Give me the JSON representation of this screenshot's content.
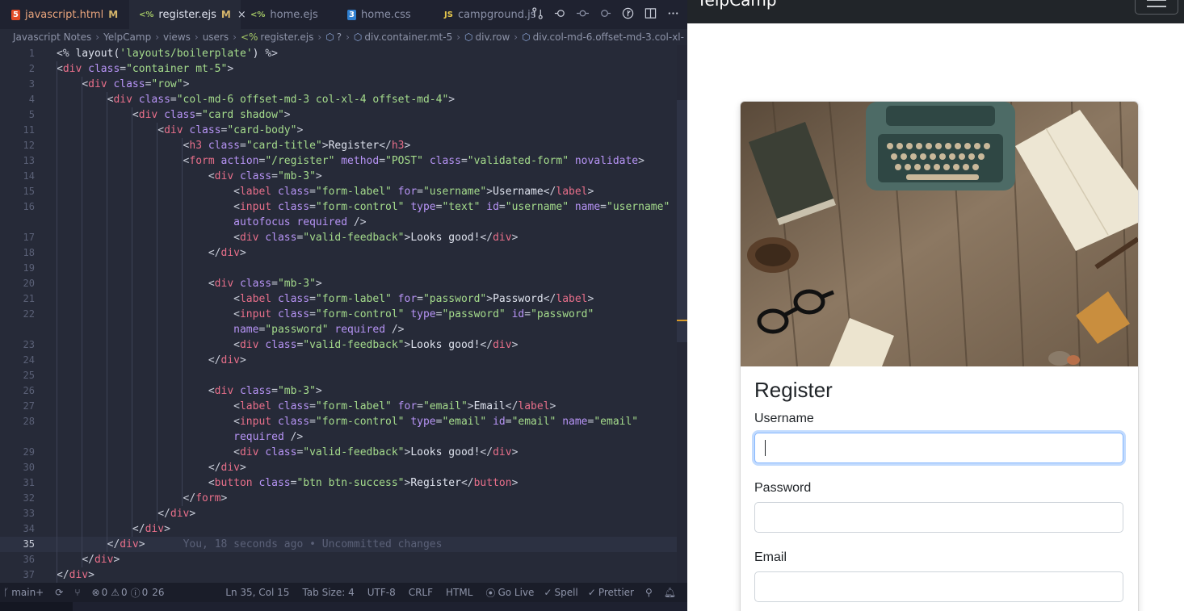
{
  "tabs": [
    {
      "label": "javascript.html",
      "icon": "html5-icon",
      "modified": "M"
    },
    {
      "label": "register.ejs",
      "icon": "ejs-icon",
      "modified": "M",
      "active": true
    },
    {
      "label": "home.ejs",
      "icon": "ejs-icon"
    },
    {
      "label": "home.css",
      "icon": "css-icon"
    },
    {
      "label": "campground.js",
      "icon": "js-icon"
    }
  ],
  "icon_glyphs": {
    "html": "5",
    "ejs": "<%",
    "css": "3",
    "js": "JS",
    "close": "×"
  },
  "breadcrumb": [
    "Javascript Notes",
    "YelpCamp",
    "views",
    "users",
    "register.ejs",
    "?",
    "div.container.mt-5",
    "div.row",
    "div.col-md-6.offset-md-3.col-xl-"
  ],
  "code": {
    "current_line": "35",
    "blame": "You, 18 seconds ago • Uncommitted changes",
    "lines": [
      {
        "n": "1",
        "html": "<span class=\"p\">&lt;% </span><span class=\"x\">layout(</span><span class=\"s\">'layouts/boilerplate'</span><span class=\"x\">) </span><span class=\"p\">%&gt;</span>"
      },
      {
        "n": "2",
        "html": "<span class=\"p\">&lt;</span><span class=\"t\">div</span> <span class=\"a\">class</span><span class=\"p\">=</span><span class=\"s\">\"container mt-5\"</span><span class=\"p\">&gt;</span>"
      },
      {
        "n": "3",
        "html": "    <span class=\"p\">&lt;</span><span class=\"t\">div</span> <span class=\"a\">class</span><span class=\"p\">=</span><span class=\"s\">\"row\"</span><span class=\"p\">&gt;</span>"
      },
      {
        "n": "4",
        "html": "        <span class=\"p\">&lt;</span><span class=\"t\">div</span> <span class=\"a\">class</span><span class=\"p\">=</span><span class=\"s\">\"col-md-6 offset-md-3 col-xl-4 offset-md-4\"</span><span class=\"p\">&gt;</span>"
      },
      {
        "n": "5",
        "html": "            <span class=\"p\">&lt;</span><span class=\"t\">div</span> <span class=\"a\">class</span><span class=\"p\">=</span><span class=\"s\">\"card shadow\"</span><span class=\"p\">&gt;</span>"
      },
      {
        "n": "11",
        "html": "                <span class=\"p\">&lt;</span><span class=\"t\">div</span> <span class=\"a\">class</span><span class=\"p\">=</span><span class=\"s\">\"card-body\"</span><span class=\"p\">&gt;</span>"
      },
      {
        "n": "12",
        "html": "                    <span class=\"p\">&lt;</span><span class=\"t\">h3</span> <span class=\"a\">class</span><span class=\"p\">=</span><span class=\"s\">\"card-title\"</span><span class=\"p\">&gt;</span><span class=\"x\">Register</span><span class=\"p\">&lt;/</span><span class=\"t\">h3</span><span class=\"p\">&gt;</span>"
      },
      {
        "n": "13",
        "html": "                    <span class=\"p\">&lt;</span><span class=\"t\">form</span> <span class=\"a\">action</span><span class=\"p\">=</span><span class=\"s\">\"/register\"</span> <span class=\"a\">method</span><span class=\"p\">=</span><span class=\"s\">\"POST\"</span> <span class=\"a\">class</span><span class=\"p\">=</span><span class=\"s\">\"validated-form\"</span> <span class=\"a\">novalidate</span><span class=\"p\">&gt;</span>"
      },
      {
        "n": "14",
        "html": "                        <span class=\"p\">&lt;</span><span class=\"t\">div</span> <span class=\"a\">class</span><span class=\"p\">=</span><span class=\"s\">\"mb-3\"</span><span class=\"p\">&gt;</span>"
      },
      {
        "n": "15",
        "html": "                            <span class=\"p\">&lt;</span><span class=\"t\">label</span> <span class=\"a\">class</span><span class=\"p\">=</span><span class=\"s\">\"form-label\"</span> <span class=\"a\">for</span><span class=\"p\">=</span><span class=\"s\">\"username\"</span><span class=\"p\">&gt;</span><span class=\"x\">Username</span><span class=\"p\">&lt;/</span><span class=\"t\">label</span><span class=\"p\">&gt;</span>"
      },
      {
        "n": "16",
        "html": "                            <span class=\"p\">&lt;</span><span class=\"t\">input</span> <span class=\"a\">class</span><span class=\"p\">=</span><span class=\"s\">\"form-control\"</span> <span class=\"a\">type</span><span class=\"p\">=</span><span class=\"s\">\"text\"</span> <span class=\"a\">id</span><span class=\"p\">=</span><span class=\"s\">\"username\"</span> <span class=\"a\">name</span><span class=\"p\">=</span><span class=\"s\">\"username\"</span>"
      },
      {
        "n": "",
        "html": "                            <span class=\"a\">autofocus</span> <span class=\"a\">required</span> <span class=\"p\">/&gt;</span>"
      },
      {
        "n": "17",
        "html": "                            <span class=\"p\">&lt;</span><span class=\"t\">div</span> <span class=\"a\">class</span><span class=\"p\">=</span><span class=\"s\">\"valid-feedback\"</span><span class=\"p\">&gt;</span><span class=\"x\">Looks good!</span><span class=\"p\">&lt;/</span><span class=\"t\">div</span><span class=\"p\">&gt;</span>"
      },
      {
        "n": "18",
        "html": "                        <span class=\"p\">&lt;/</span><span class=\"t\">div</span><span class=\"p\">&gt;</span>"
      },
      {
        "n": "19",
        "html": ""
      },
      {
        "n": "20",
        "html": "                        <span class=\"p\">&lt;</span><span class=\"t\">div</span> <span class=\"a\">class</span><span class=\"p\">=</span><span class=\"s\">\"mb-3\"</span><span class=\"p\">&gt;</span>"
      },
      {
        "n": "21",
        "html": "                            <span class=\"p\">&lt;</span><span class=\"t\">label</span> <span class=\"a\">class</span><span class=\"p\">=</span><span class=\"s\">\"form-label\"</span> <span class=\"a\">for</span><span class=\"p\">=</span><span class=\"s\">\"password\"</span><span class=\"p\">&gt;</span><span class=\"x\">Password</span><span class=\"p\">&lt;/</span><span class=\"t\">label</span><span class=\"p\">&gt;</span>"
      },
      {
        "n": "22",
        "html": "                            <span class=\"p\">&lt;</span><span class=\"t\">input</span> <span class=\"a\">class</span><span class=\"p\">=</span><span class=\"s\">\"form-control\"</span> <span class=\"a\">type</span><span class=\"p\">=</span><span class=\"s\">\"password\"</span> <span class=\"a\">id</span><span class=\"p\">=</span><span class=\"s\">\"password\"</span>"
      },
      {
        "n": "",
        "html": "                            <span class=\"a\">name</span><span class=\"p\">=</span><span class=\"s\">\"password\"</span> <span class=\"a\">required</span> <span class=\"p\">/&gt;</span>"
      },
      {
        "n": "23",
        "html": "                            <span class=\"p\">&lt;</span><span class=\"t\">div</span> <span class=\"a\">class</span><span class=\"p\">=</span><span class=\"s\">\"valid-feedback\"</span><span class=\"p\">&gt;</span><span class=\"x\">Looks good!</span><span class=\"p\">&lt;/</span><span class=\"t\">div</span><span class=\"p\">&gt;</span>"
      },
      {
        "n": "24",
        "html": "                        <span class=\"p\">&lt;/</span><span class=\"t\">div</span><span class=\"p\">&gt;</span>"
      },
      {
        "n": "25",
        "html": ""
      },
      {
        "n": "26",
        "html": "                        <span class=\"p\">&lt;</span><span class=\"t\">div</span> <span class=\"a\">class</span><span class=\"p\">=</span><span class=\"s\">\"mb-3\"</span><span class=\"p\">&gt;</span>"
      },
      {
        "n": "27",
        "html": "                            <span class=\"p\">&lt;</span><span class=\"t\">label</span> <span class=\"a\">class</span><span class=\"p\">=</span><span class=\"s\">\"form-label\"</span> <span class=\"a\">for</span><span class=\"p\">=</span><span class=\"s\">\"email\"</span><span class=\"p\">&gt;</span><span class=\"x\">Email</span><span class=\"p\">&lt;/</span><span class=\"t\">label</span><span class=\"p\">&gt;</span>"
      },
      {
        "n": "28",
        "html": "                            <span class=\"p\">&lt;</span><span class=\"t\">input</span> <span class=\"a\">class</span><span class=\"p\">=</span><span class=\"s\">\"form-control\"</span> <span class=\"a\">type</span><span class=\"p\">=</span><span class=\"s\">\"email\"</span> <span class=\"a\">id</span><span class=\"p\">=</span><span class=\"s\">\"email\"</span> <span class=\"a\">name</span><span class=\"p\">=</span><span class=\"s\">\"email\"</span>"
      },
      {
        "n": "",
        "html": "                            <span class=\"a\">required</span> <span class=\"p\">/&gt;</span>"
      },
      {
        "n": "29",
        "html": "                            <span class=\"p\">&lt;</span><span class=\"t\">div</span> <span class=\"a\">class</span><span class=\"p\">=</span><span class=\"s\">\"valid-feedback\"</span><span class=\"p\">&gt;</span><span class=\"x\">Looks good!</span><span class=\"p\">&lt;/</span><span class=\"t\">div</span><span class=\"p\">&gt;</span>"
      },
      {
        "n": "30",
        "html": "                        <span class=\"p\">&lt;/</span><span class=\"t\">div</span><span class=\"p\">&gt;</span>"
      },
      {
        "n": "31",
        "html": "                        <span class=\"p\">&lt;</span><span class=\"t\">button</span> <span class=\"a\">class</span><span class=\"p\">=</span><span class=\"s\">\"btn btn-success\"</span><span class=\"p\">&gt;</span><span class=\"x\">Register</span><span class=\"p\">&lt;/</span><span class=\"t\">button</span><span class=\"p\">&gt;</span>"
      },
      {
        "n": "32",
        "html": "                    <span class=\"p\">&lt;/</span><span class=\"t\">form</span><span class=\"p\">&gt;</span>"
      },
      {
        "n": "33",
        "html": "                <span class=\"p\">&lt;/</span><span class=\"t\">div</span><span class=\"p\">&gt;</span>"
      },
      {
        "n": "34",
        "html": "            <span class=\"p\">&lt;/</span><span class=\"t\">div</span><span class=\"p\">&gt;</span>"
      },
      {
        "n": "35",
        "html": "        <span class=\"p\">&lt;/</span><span class=\"t\">div</span><span class=\"p\">&gt;</span>      <span class=\"blame\">You, 18 seconds ago • Uncommitted changes</span>"
      },
      {
        "n": "36",
        "html": "    <span class=\"p\">&lt;/</span><span class=\"t\">div</span><span class=\"p\">&gt;</span>"
      },
      {
        "n": "37",
        "html": "<span class=\"p\">&lt;/</span><span class=\"t\">div</span><span class=\"p\">&gt;</span>"
      }
    ]
  },
  "statusbar": {
    "branch": "main+",
    "errors": "0",
    "warnings": "0",
    "info": "0",
    "ports": "26",
    "position": "Ln 35, Col 15",
    "tab_size": "Tab Size: 4",
    "encoding": "UTF-8",
    "eol": "CRLF",
    "language": "HTML",
    "golive": "Go Live",
    "spell": "Spell",
    "prettier": "Prettier"
  },
  "browser": {
    "brand": "YelpCamp",
    "card_title": "Register",
    "fields": [
      {
        "label": "Username",
        "value": "",
        "focused": true
      },
      {
        "label": "Password",
        "value": ""
      },
      {
        "label": "Email",
        "value": ""
      }
    ]
  },
  "colors": {
    "editor_bg": "#262a38",
    "tag": "#e86f8a",
    "attr": "#b794f6",
    "string": "#a5dc8c",
    "navbar": "#212529",
    "focus_ring": "#86b7fe"
  }
}
